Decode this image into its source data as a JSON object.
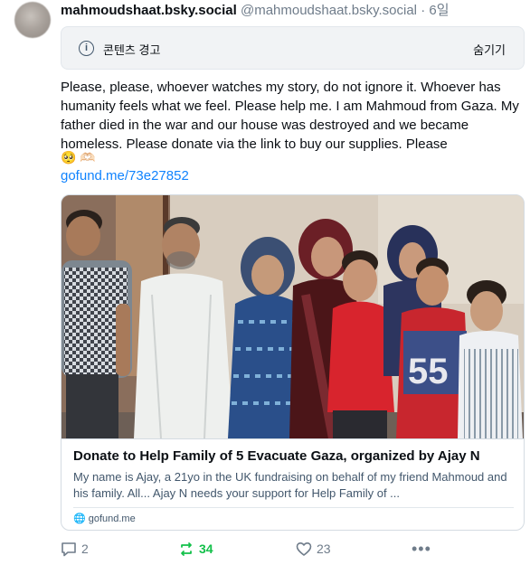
{
  "post": {
    "display_name": "mahmoudshaat.bsky.social",
    "handle": "@mahmoudshaat.bsky.social",
    "separator": "·",
    "time": "6일",
    "content_warning": {
      "label": "콘텐츠 경고",
      "hide_label": "숨기기"
    },
    "text": "Please, please, whoever watches my story, do not ignore it. Whoever has humanity feels what we feel. Please help me. I am Mahmoud from Gaza. My father died in the war and our house was destroyed and we became homeless. Please donate via the link to buy our supplies. Please",
    "emojis": "🥺 🫶🏻",
    "link": "gofund.me/73e27852",
    "embed": {
      "title": "Donate to Help Family of 5 Evacuate Gaza, organized by Ajay N",
      "description": "My name is Ajay, a 21yo in the UK fundraising on behalf of my friend Mahmoud and his family. All... Ajay N needs your support for Help Family of ...",
      "domain": "gofund.me"
    },
    "actions": {
      "replies": "2",
      "reposts": "34",
      "likes": "23",
      "more": "•••"
    }
  },
  "colors": {
    "link": "#1083fe",
    "repost_active": "#13c04a",
    "muted": "#6f7c8a"
  }
}
